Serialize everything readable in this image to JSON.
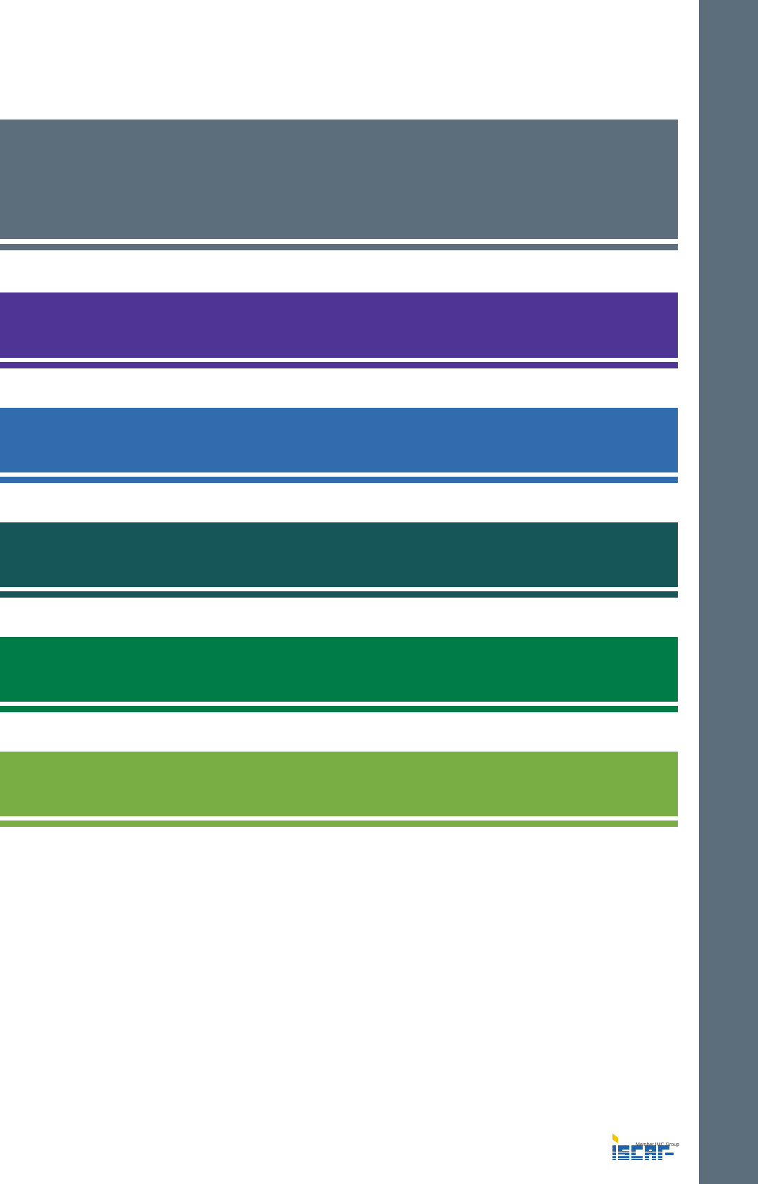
{
  "colors": {
    "side_tab": "#5d6d7c",
    "bands": [
      "#5d6d7c",
      "#4e3595",
      "#316cae",
      "#185558",
      "#007d47",
      "#79ae44"
    ]
  },
  "logo": {
    "icon": "iscar-logo-icon",
    "tagline": "Member IMC Group"
  }
}
